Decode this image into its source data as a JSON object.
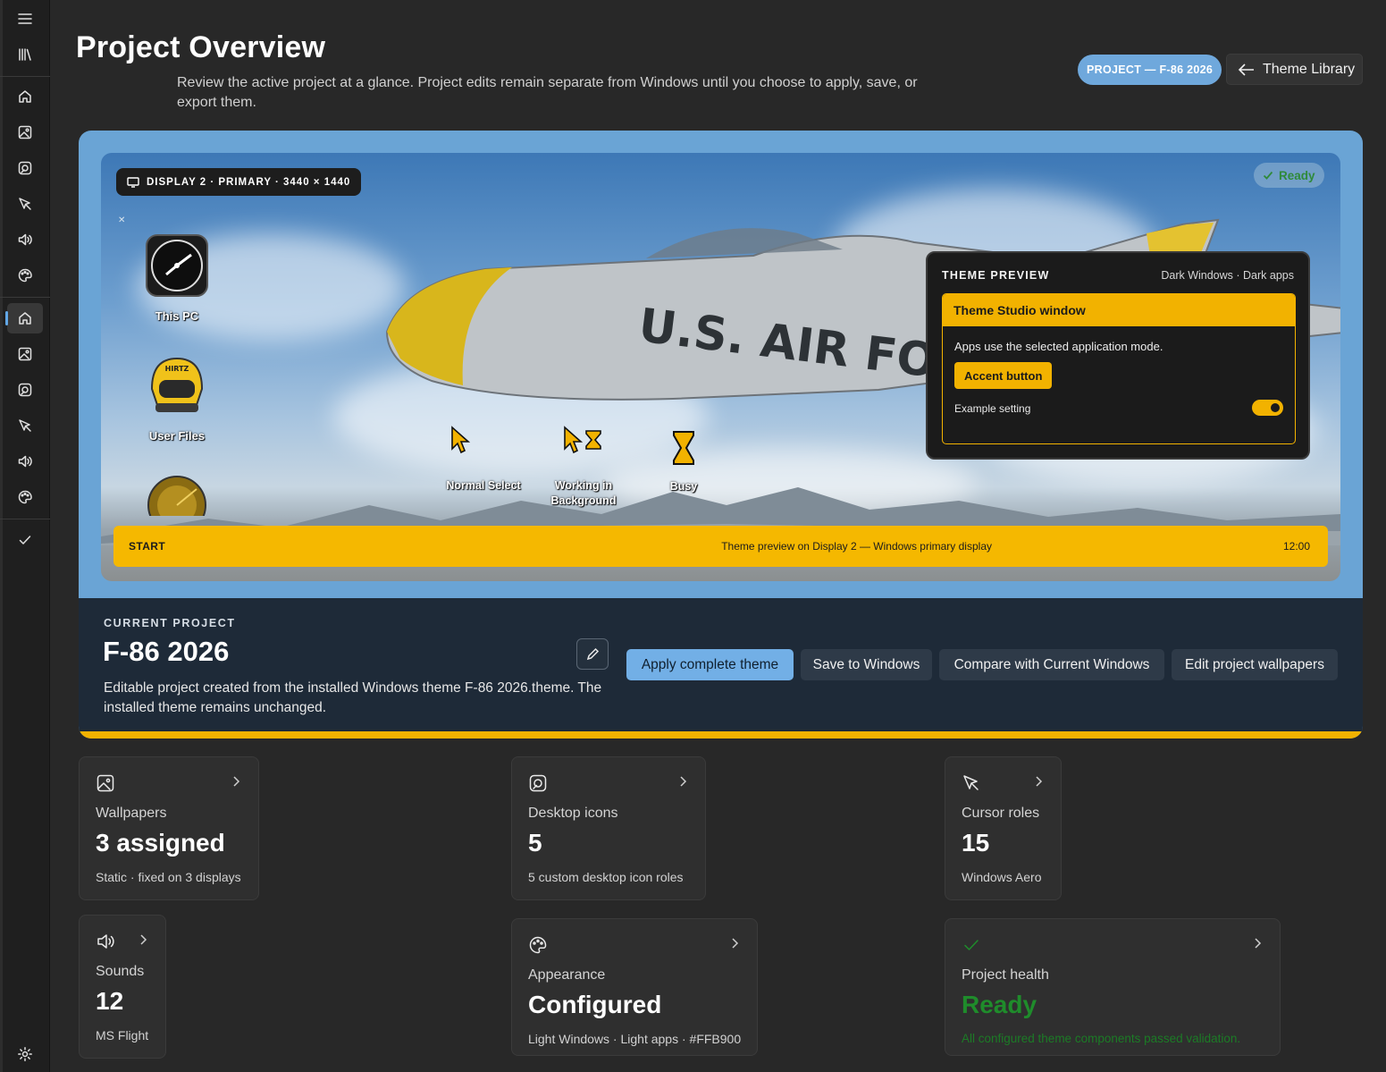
{
  "page": {
    "title": "Project Overview",
    "description": "Review the active project at a glance. Project edits remain separate from Windows until you choose to apply, save, or export them.",
    "project_badge": "PROJECT — F-86 2026",
    "library_button": "Theme Library"
  },
  "rail": {
    "icons": [
      "menu-icon",
      "library-icon",
      "home-icon",
      "wallpaper-icon",
      "desktop-icons-icon",
      "cursor-icon",
      "sound-icon",
      "palette-icon",
      "home-icon",
      "wallpaper-icon",
      "desktop-icons-icon",
      "cursor-icon",
      "sound-icon",
      "palette-icon",
      "check-icon",
      "settings-icon"
    ],
    "active_item": "home"
  },
  "preview": {
    "display_chip": "DISPLAY 2 · PRIMARY · 3440 × 1440",
    "status": "Ready",
    "desktop_icons": [
      "This PC",
      "User Files"
    ],
    "cursors": [
      "Normal Select",
      "Working in Background",
      "Busy"
    ],
    "theme_panel": {
      "heading": "THEME PREVIEW",
      "mode": "Dark Windows · Dark apps",
      "window_title": "Theme Studio window",
      "body_text": "Apps use the selected application mode.",
      "accent_button": "Accent button",
      "setting_label": "Example setting",
      "toggle_on": true
    },
    "taskbar": {
      "start": "START",
      "center": "Theme preview on Display 2 — Windows primary display",
      "clock": "12:00"
    }
  },
  "current_project": {
    "label": "CURRENT PROJECT",
    "name": "F-86 2026",
    "description": "Editable project created from the installed Windows theme F-86 2026.theme. The installed theme remains unchanged.",
    "actions": {
      "apply": "Apply complete theme",
      "save": "Save to Windows",
      "compare": "Compare with Current Windows",
      "edit_wallpapers": "Edit project wallpapers"
    }
  },
  "cards": {
    "wallpapers": {
      "category": "Wallpapers",
      "value": "3 assigned",
      "detail": "Static · fixed on 3 displays"
    },
    "desktop_icons": {
      "category": "Desktop icons",
      "value": "5",
      "detail": "5 custom desktop icon roles"
    },
    "cursors": {
      "category": "Cursor roles",
      "value": "15",
      "detail": "Windows Aero"
    },
    "sounds": {
      "category": "Sounds",
      "value": "12",
      "detail": "MS Flight"
    },
    "appearance": {
      "category": "Appearance",
      "value": "Configured",
      "detail": "Light Windows · Light apps · #FFB900"
    },
    "health": {
      "category": "Project health",
      "value": "Ready",
      "detail": "All configured theme components passed validation."
    }
  },
  "colors": {
    "accent": "#FFB900",
    "project_badge": "#6FA8DC",
    "primary_button": "#72AFE6",
    "ready_green": "#1F8C2B",
    "background": "#282828"
  }
}
